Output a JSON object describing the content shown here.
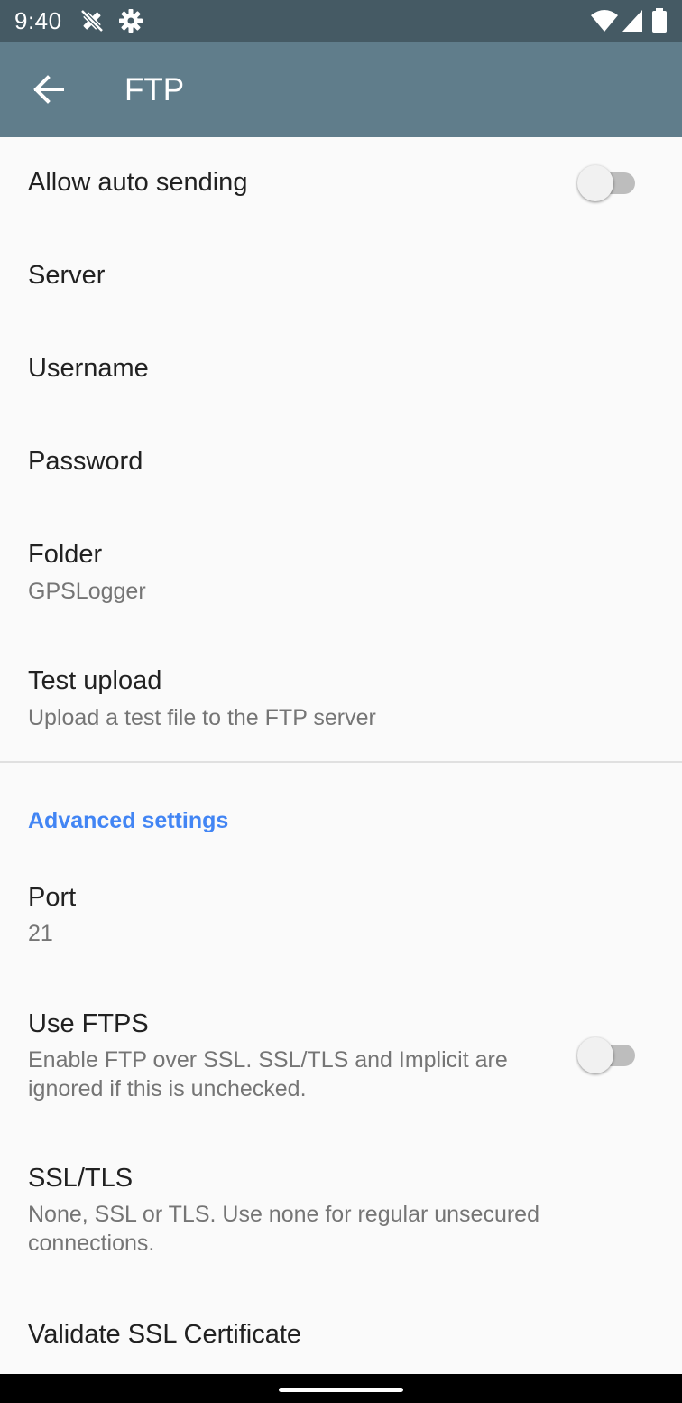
{
  "status_bar": {
    "time": "9:40",
    "icons": [
      "satellite-off-icon",
      "settings-icon",
      "wifi-icon",
      "cell-signal-icon",
      "battery-icon"
    ]
  },
  "app_bar": {
    "title": "FTP",
    "back_icon": "arrow-back-icon"
  },
  "preferences": {
    "allow_auto_sending": {
      "title": "Allow auto sending",
      "checked": false
    },
    "server": {
      "title": "Server"
    },
    "username": {
      "title": "Username"
    },
    "password": {
      "title": "Password"
    },
    "folder": {
      "title": "Folder",
      "summary": "GPSLogger"
    },
    "test_upload": {
      "title": "Test upload",
      "summary": "Upload a test file to the FTP server"
    }
  },
  "advanced": {
    "header": "Advanced settings",
    "port": {
      "title": "Port",
      "summary": "21"
    },
    "use_ftps": {
      "title": "Use FTPS",
      "summary": "Enable FTP over SSL. SSL/TLS and Implicit are ignored if this is unchecked.",
      "checked": false
    },
    "ssl_tls": {
      "title": "SSL/TLS",
      "summary": "None, SSL or TLS. Use none for regular unsecured connections."
    },
    "validate_ssl": {
      "title": "Validate SSL Certificate"
    }
  },
  "colors": {
    "status_bar": "#455a64",
    "app_bar": "#607d8b",
    "accent": "#4285f4",
    "background": "#fafafa"
  }
}
